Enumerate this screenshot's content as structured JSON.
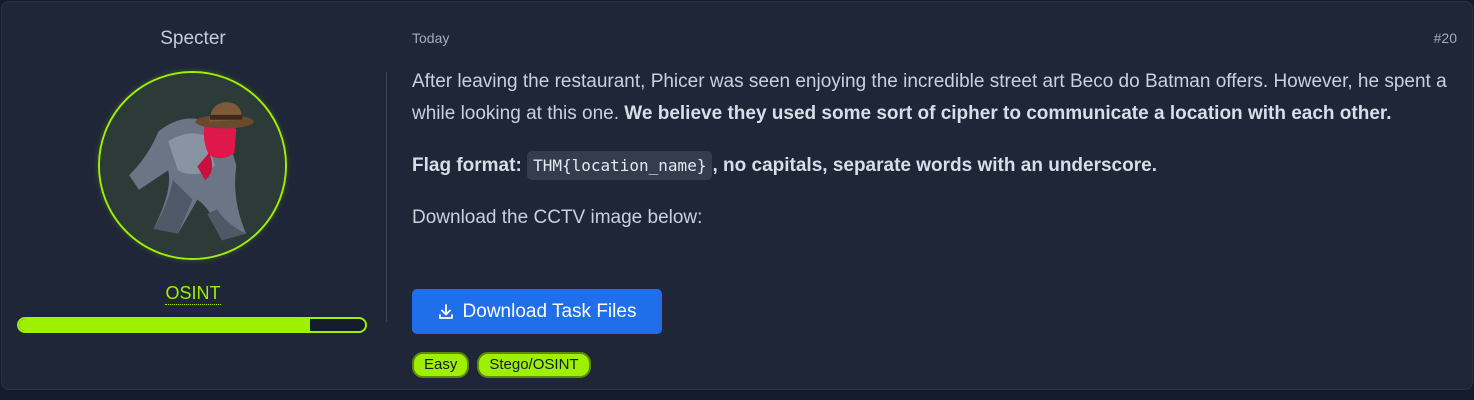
{
  "author": {
    "name": "Specter",
    "category": "OSINT",
    "progress_fraction": 0.84,
    "accent_color": "#9fef00"
  },
  "post": {
    "date": "Today",
    "number": "#20",
    "para1_plain": "After leaving the restaurant, Phicer was seen enjoying the incredible street art Beco do Batman offers. However, he spent a while looking at this one. ",
    "para1_bold": "We believe they used some sort of cipher to communicate a location with each other.",
    "flag_label": "Flag format:",
    "flag_code": "THM{location_name}",
    "flag_rest": ", no capitals, separate words with an underscore.",
    "para3": "Download the CCTV image below:"
  },
  "download_button": {
    "icon": "download-icon",
    "label": "Download Task Files",
    "color": "#1f6feb"
  },
  "tags": [
    "Easy",
    "Stego/OSINT"
  ]
}
